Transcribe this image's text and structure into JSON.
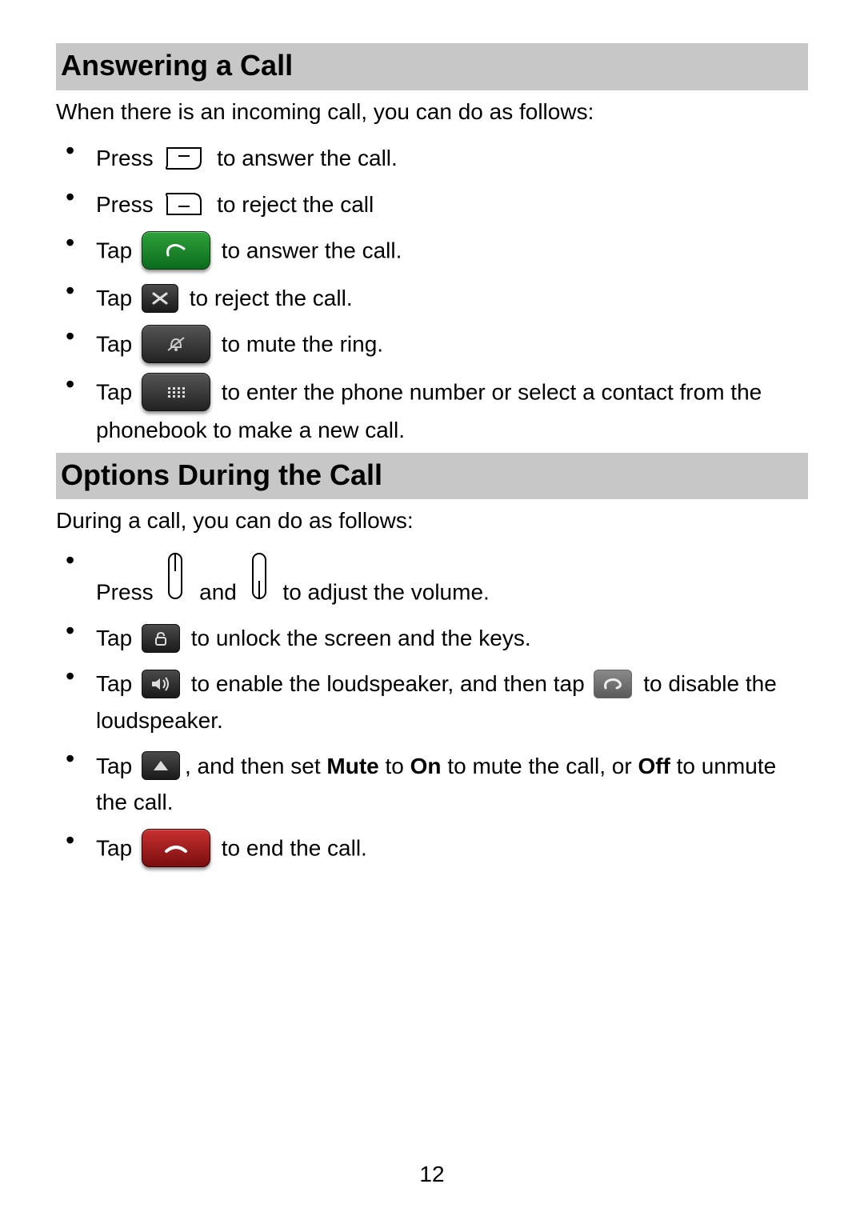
{
  "page_number": "12",
  "sections": [
    {
      "heading": "Answering a Call",
      "intro": "When there is an incoming call, you can do as follows:",
      "items": [
        [
          {
            "type": "text",
            "value": "Press "
          },
          {
            "type": "icon",
            "name": "send-key",
            "interactable": true
          },
          {
            "type": "text",
            "value": " to answer the call."
          }
        ],
        [
          {
            "type": "text",
            "value": "Press "
          },
          {
            "type": "icon",
            "name": "end-key",
            "interactable": true
          },
          {
            "type": "text",
            "value": " to reject the call"
          }
        ],
        [
          {
            "type": "text",
            "value": "Tap "
          },
          {
            "type": "icon",
            "name": "answer-btn",
            "interactable": true
          },
          {
            "type": "text",
            "value": " to answer the call."
          }
        ],
        [
          {
            "type": "text",
            "value": "Tap "
          },
          {
            "type": "icon",
            "name": "reject-btn",
            "interactable": true
          },
          {
            "type": "text",
            "value": " to reject the call."
          }
        ],
        [
          {
            "type": "text",
            "value": "Tap "
          },
          {
            "type": "icon",
            "name": "mute-btn",
            "interactable": true
          },
          {
            "type": "text",
            "value": " to mute the ring."
          }
        ],
        [
          {
            "type": "text",
            "value": "Tap "
          },
          {
            "type": "icon",
            "name": "dialpad-btn",
            "interactable": true
          },
          {
            "type": "text",
            "value": " to enter the phone number or select a contact from the phonebook to make a new call."
          }
        ]
      ]
    },
    {
      "heading": "Options During the Call",
      "intro": "During a call, you can do as follows:",
      "items": [
        [
          {
            "type": "text",
            "value": "Press "
          },
          {
            "type": "icon",
            "name": "volup",
            "interactable": true
          },
          {
            "type": "text",
            "value": " and "
          },
          {
            "type": "icon",
            "name": "voldown",
            "interactable": true
          },
          {
            "type": "text",
            "value": " to adjust the volume."
          }
        ],
        [
          {
            "type": "text",
            "value": "Tap "
          },
          {
            "type": "icon",
            "name": "unlock-btn",
            "interactable": true
          },
          {
            "type": "text",
            "value": " to unlock the screen and the keys."
          }
        ],
        [
          {
            "type": "text",
            "value": "Tap "
          },
          {
            "type": "icon",
            "name": "speaker-on-btn",
            "interactable": true
          },
          {
            "type": "text",
            "value": " to enable the loudspeaker, and then tap "
          },
          {
            "type": "icon",
            "name": "speaker-off-btn",
            "interactable": true
          },
          {
            "type": "text",
            "value": " to disable the loudspeaker."
          }
        ],
        [
          {
            "type": "text",
            "value": "Tap "
          },
          {
            "type": "icon",
            "name": "options-btn",
            "interactable": true
          },
          {
            "type": "text",
            "value": ", and then set "
          },
          {
            "type": "bold",
            "value": "Mute"
          },
          {
            "type": "text",
            "value": " to "
          },
          {
            "type": "bold",
            "value": "On"
          },
          {
            "type": "text",
            "value": " to mute the call, or "
          },
          {
            "type": "bold",
            "value": "Off"
          },
          {
            "type": "text",
            "value": " to unmute the call."
          }
        ],
        [
          {
            "type": "text",
            "value": "Tap "
          },
          {
            "type": "icon",
            "name": "endcall-btn",
            "interactable": true
          },
          {
            "type": "text",
            "value": " to end the call."
          }
        ]
      ]
    }
  ]
}
